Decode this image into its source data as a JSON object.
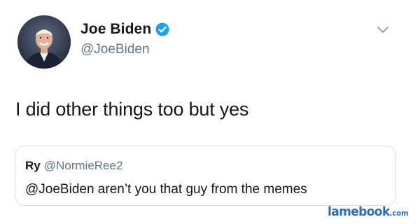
{
  "tweet": {
    "author": {
      "display_name": "Joe Biden",
      "handle": "@JoeBiden",
      "verified": true,
      "avatar_icon": "profile-photo"
    },
    "text": "I did other things too but yes",
    "menu_icon": "chevron-down-icon",
    "quoted_reply": {
      "name": "Ry",
      "handle": "@NormieRee2",
      "text": "@JoeBiden aren’t you that guy from the memes"
    }
  },
  "watermark": {
    "main": "lamebook",
    "tld": ".com"
  },
  "colors": {
    "verified_blue": "#1da1f2",
    "handle_gray": "#657786",
    "text_dark": "#14171a",
    "card_border": "#d9dee3",
    "watermark_blue": "#2f6db5"
  }
}
